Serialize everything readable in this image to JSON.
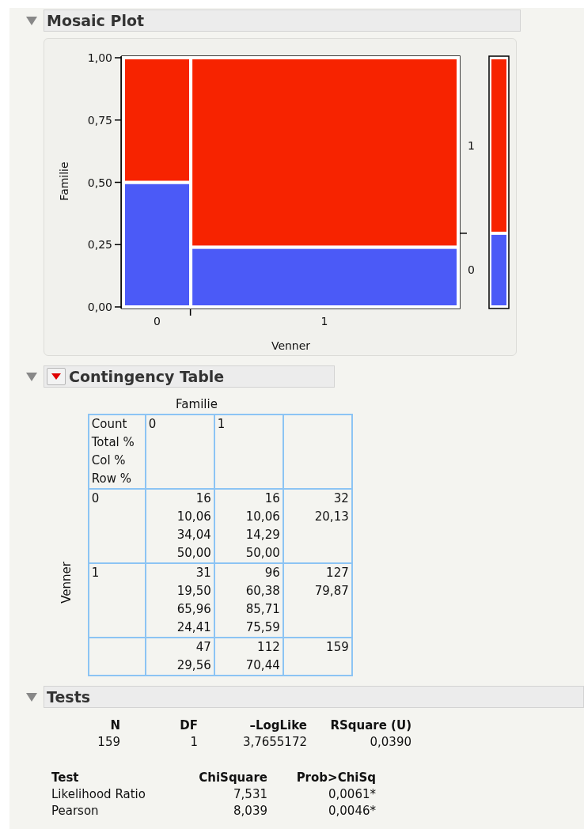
{
  "sections": [
    {
      "kind": "mosaic",
      "title": "Mosaic Plot",
      "expanded": true,
      "chart_data": {
        "type": "bar",
        "stacked": true,
        "xlabel": "Venner",
        "ylabel": "Familie",
        "categories": [
          "0",
          "1"
        ],
        "ylim": [
          0,
          1
        ],
        "yticks": [
          {
            "value": 0,
            "label": "0,00"
          },
          {
            "value": 0.25,
            "label": "0,25"
          },
          {
            "value": 0.5,
            "label": "0,50"
          },
          {
            "value": 0.75,
            "label": "0,75"
          },
          {
            "value": 1,
            "label": "1,00"
          }
        ],
        "series": [
          {
            "name": "0",
            "color": "#4b5af7",
            "values": [
              0.5,
              0.24
            ]
          },
          {
            "name": "1",
            "color": "#f72300",
            "values": [
              0.5,
              0.76
            ]
          }
        ]
      }
    },
    {
      "kind": "contingency",
      "title": "Contingency Table",
      "expanded": true,
      "has_menu": true,
      "column_variable": "Familie",
      "row_variable": "Venner",
      "legend": [
        "Count",
        "Total %",
        "Col %",
        "Row %"
      ],
      "columns": [
        "0",
        "1"
      ],
      "rows": [
        {
          "label": "0",
          "cells": [
            [
              "16",
              "10,06",
              "34,04",
              "50,00"
            ],
            [
              "16",
              "10,06",
              "14,29",
              "50,00"
            ],
            [
              "32",
              "20,13"
            ]
          ]
        },
        {
          "label": "1",
          "cells": [
            [
              "31",
              "19,50",
              "65,96",
              "24,41"
            ],
            [
              "96",
              "60,38",
              "85,71",
              "75,59"
            ],
            [
              "127",
              "79,87"
            ]
          ]
        },
        {
          "cells": [
            [
              "47",
              "29,56"
            ],
            [
              "112",
              "70,44"
            ],
            [
              "159"
            ]
          ]
        }
      ]
    },
    {
      "kind": "tests",
      "title": "Tests",
      "expanded": true,
      "summary": {
        "columns": [
          "N",
          "DF",
          "–LogLike",
          "RSquare (U)"
        ],
        "values": [
          "159",
          "1",
          "3,7655172",
          "0,0390"
        ]
      },
      "tests": {
        "columns": [
          "Test",
          "ChiSquare",
          "Prob>ChiSq"
        ],
        "rows": [
          [
            "Likelihood Ratio",
            "7,531",
            "0,0061*"
          ],
          [
            "Pearson",
            "8,039",
            "0,0046*"
          ]
        ]
      }
    }
  ]
}
